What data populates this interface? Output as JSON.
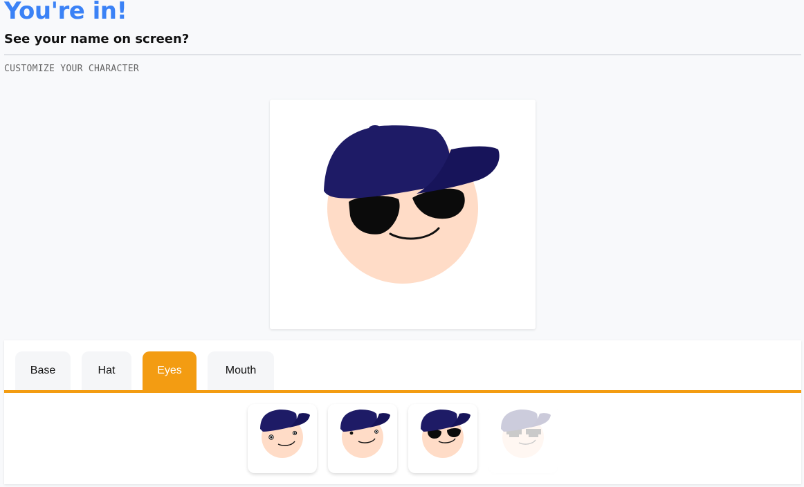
{
  "header": {
    "title": "You're in!",
    "subtitle": "See your name on screen?"
  },
  "customize": {
    "section_label": "CUSTOMIZE YOUR CHARACTER"
  },
  "character": {
    "skin_color": "#ffdcc7",
    "hat_color": "#1e1b66",
    "hat": "baseball-cap",
    "eyes": "sunglasses",
    "mouth": "smile"
  },
  "tabs": [
    {
      "label": "Base",
      "active": false
    },
    {
      "label": "Hat",
      "active": false
    },
    {
      "label": "Eyes",
      "active": true
    },
    {
      "label": "Mouth",
      "active": false
    }
  ],
  "colors": {
    "title": "#3b82f6",
    "accent": "#f39c12",
    "background": "#f8f9fb"
  },
  "eye_options": [
    {
      "name": "googly-eyes",
      "disabled": false
    },
    {
      "name": "dot-eyes",
      "disabled": false
    },
    {
      "name": "sunglasses",
      "disabled": false
    },
    {
      "name": "pixel-shades",
      "disabled": true
    }
  ]
}
